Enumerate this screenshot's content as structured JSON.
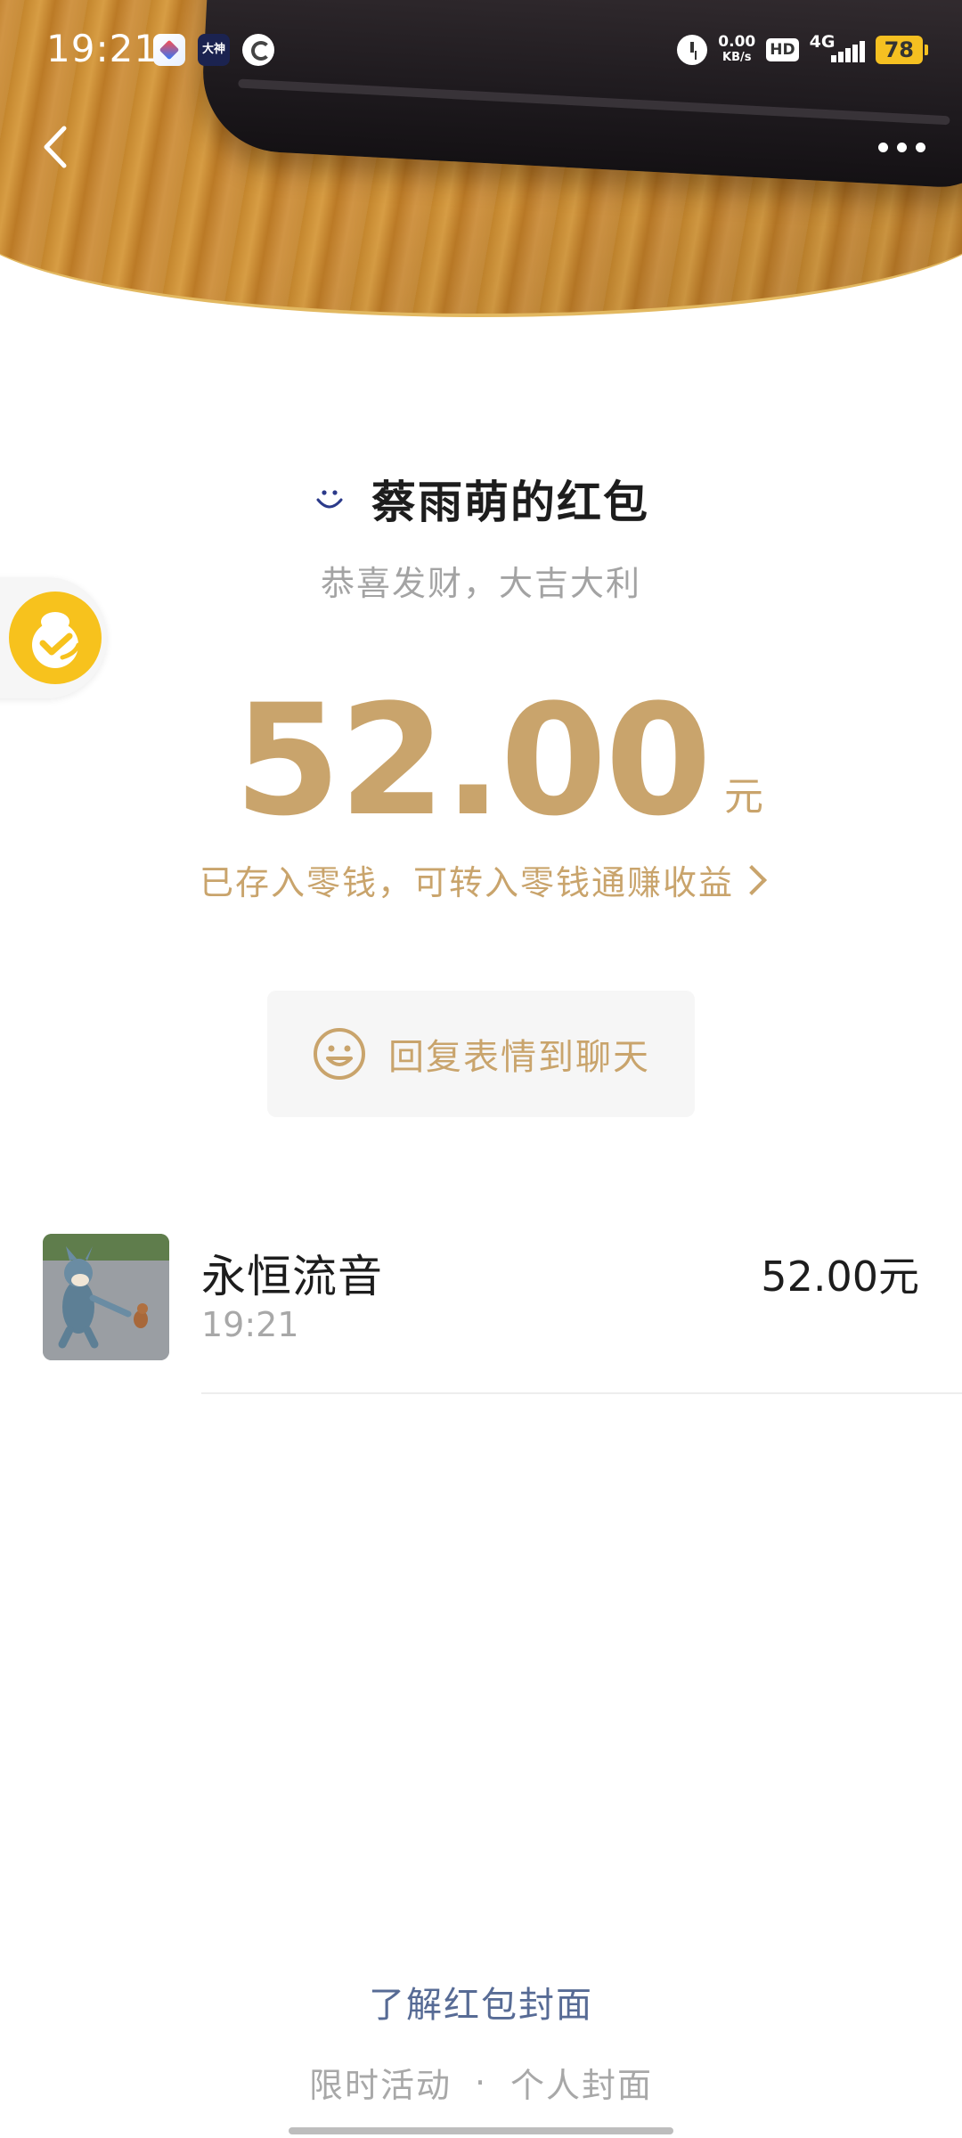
{
  "status_bar": {
    "time": "19:21",
    "app_badge_2": "大神",
    "net_speed_value": "0.00",
    "net_speed_unit": "KB/s",
    "hd_label": "HD",
    "network_type": "4G",
    "battery_level": "78"
  },
  "header": {
    "cover_photo": "phone-on-wooden-table",
    "back_icon": "chevron-left-icon",
    "more_icon": "more-dots-icon"
  },
  "envelope": {
    "sender_title": "蔡雨萌的红包",
    "blessing": "恭喜发财，大吉大利",
    "amount": "52.00",
    "unit": "元",
    "wallet_link": "已存入零钱，可转入零钱通赚收益",
    "reply_label": "回复表情到聊天"
  },
  "receivers": [
    {
      "name": "永恒流音",
      "time": "19:21",
      "amount": "52.00元"
    }
  ],
  "footer": {
    "cover_link": "了解红包封面",
    "limited_activity": "限时活动",
    "separator": "·",
    "personal_cover": "个人封面"
  },
  "colors": {
    "gold": "#c9a46c",
    "link_blue": "#576b95",
    "float_yellow": "#f7c21d",
    "border_gold": "#e2b860"
  }
}
